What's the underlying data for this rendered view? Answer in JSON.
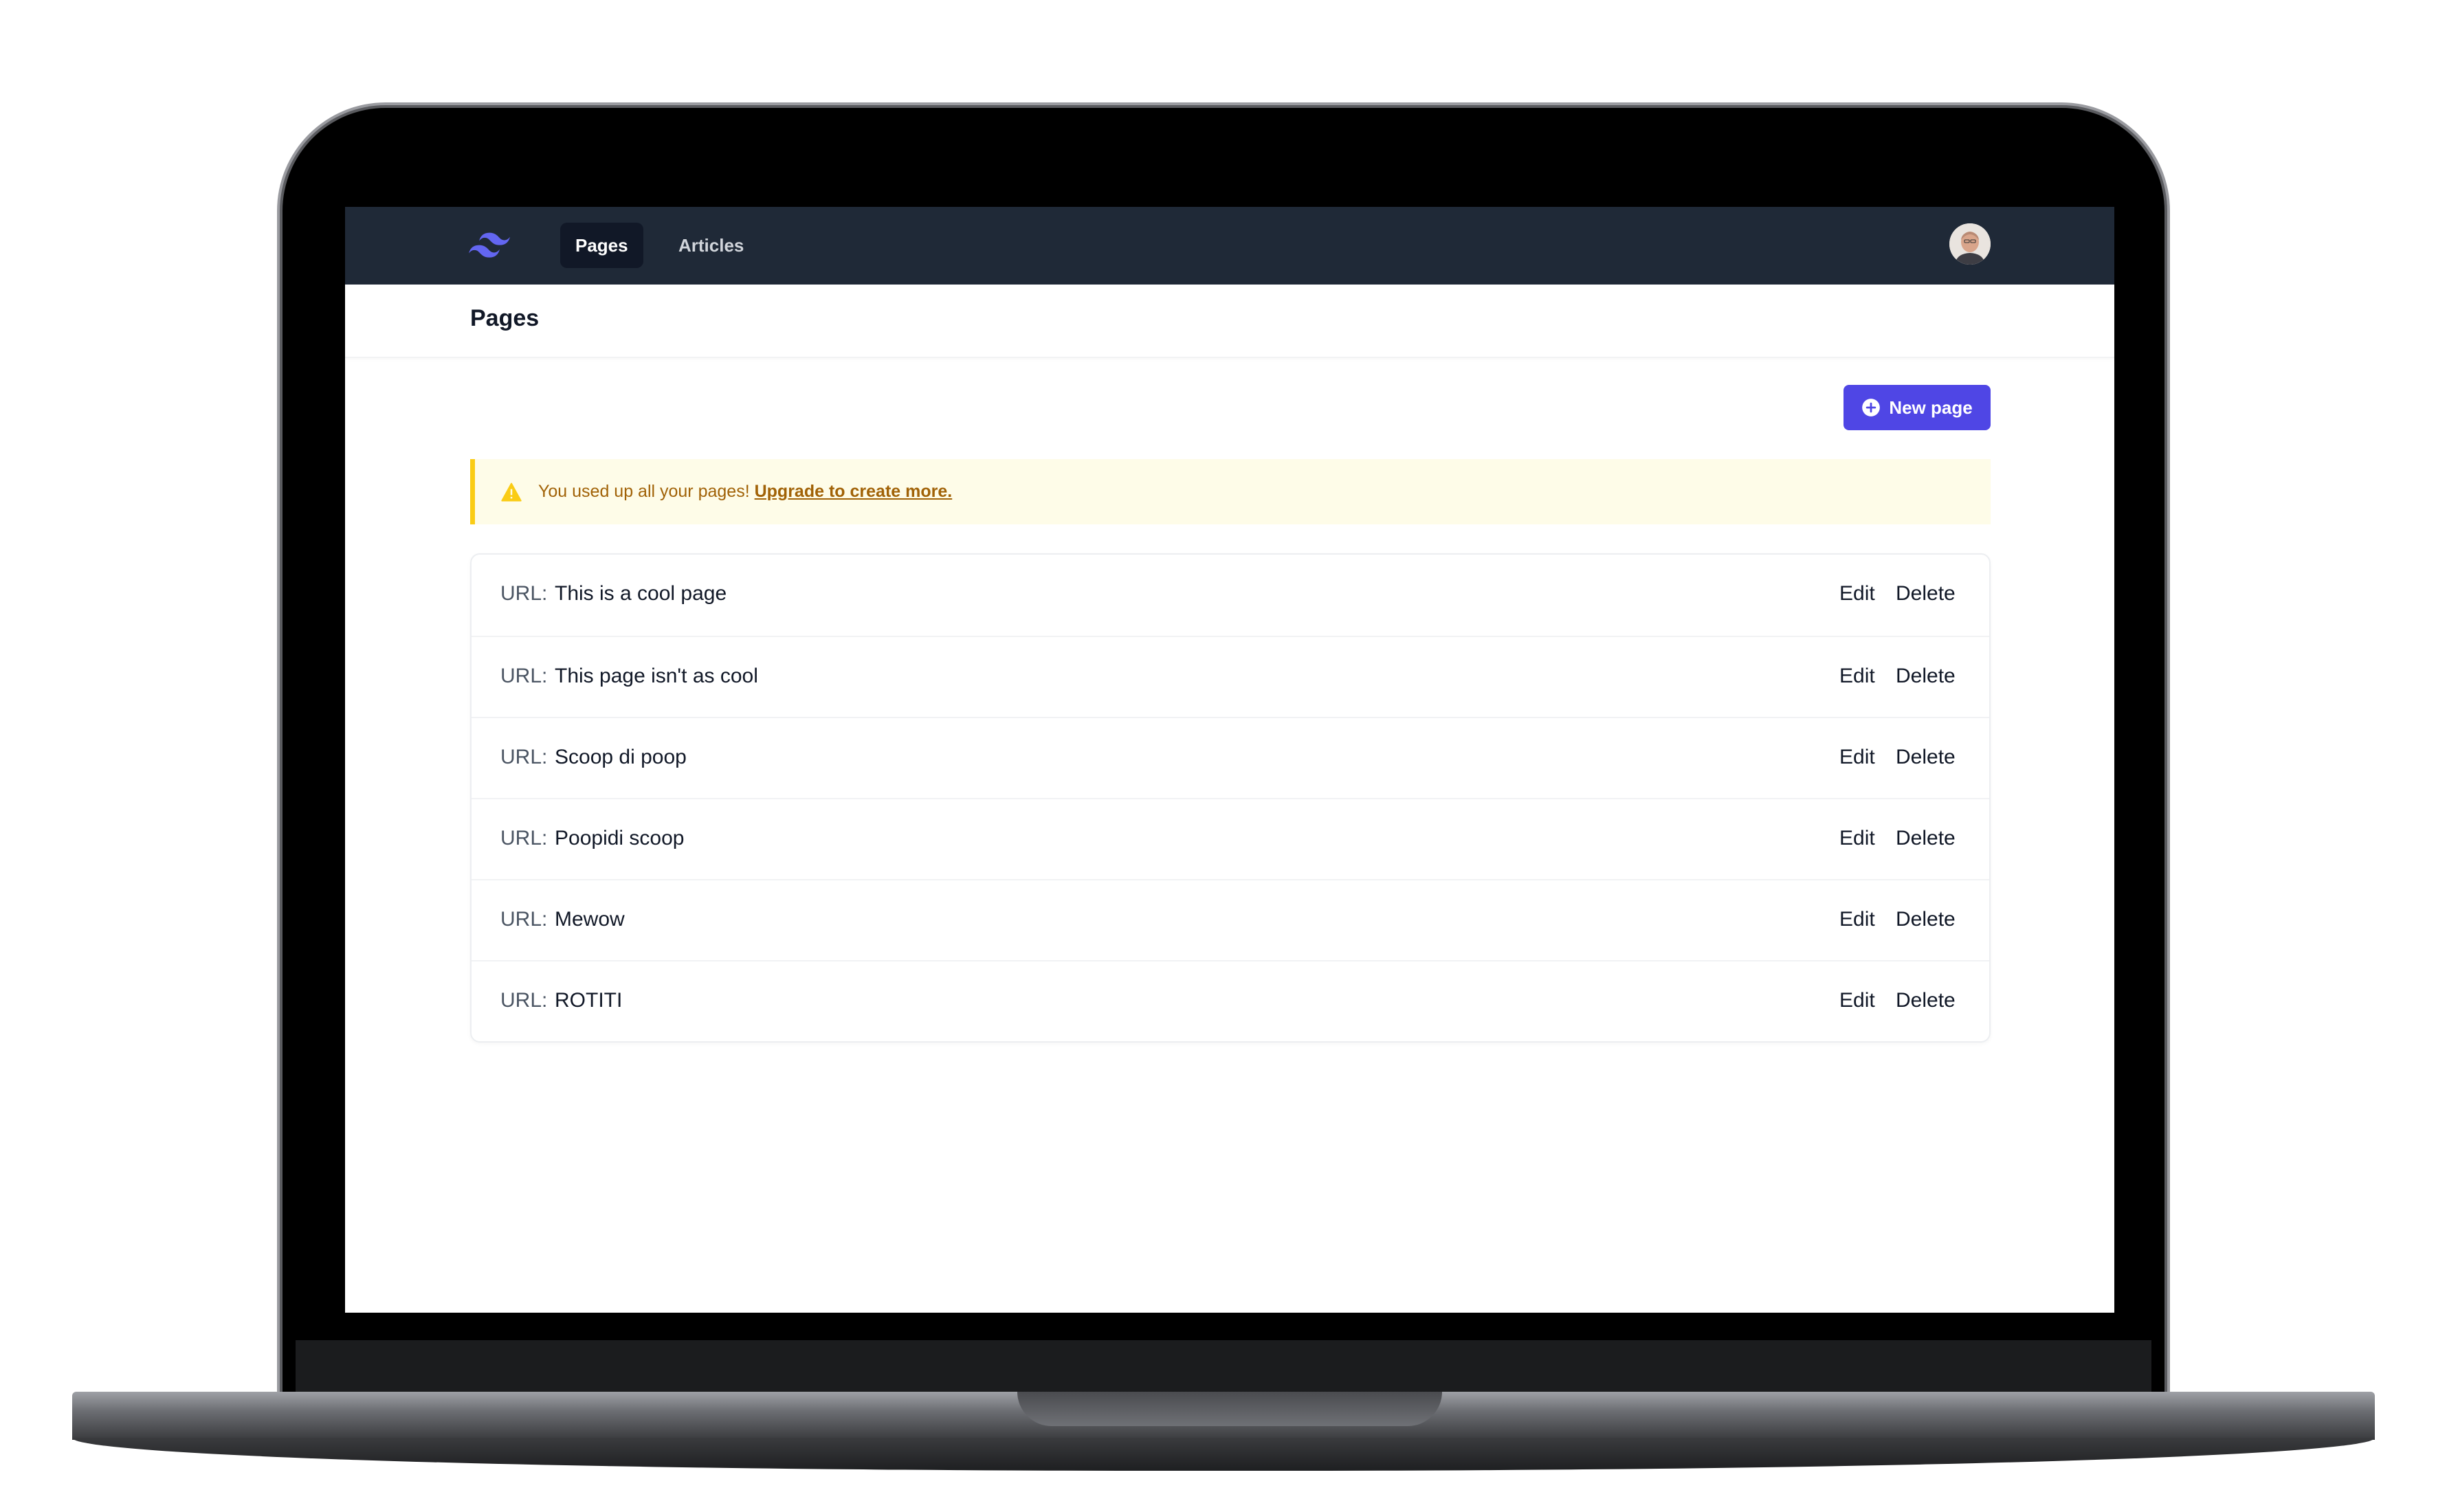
{
  "navbar": {
    "logo": "tailwind-logo-icon",
    "tabs": [
      {
        "label": "Pages",
        "active": true
      },
      {
        "label": "Articles",
        "active": false
      }
    ],
    "avatar": "user-avatar"
  },
  "header": {
    "title": "Pages"
  },
  "actions": {
    "new_page_label": "New page",
    "new_page_icon": "plus-circle-icon"
  },
  "alert": {
    "icon": "warning-icon",
    "text": "You used up all your pages!",
    "link": "Upgrade to create more."
  },
  "pages": [
    {
      "label": "URL:",
      "value": "This is a cool page",
      "edit": "Edit",
      "delete": "Delete"
    },
    {
      "label": "URL:",
      "value": "This page isn't as cool",
      "edit": "Edit",
      "delete": "Delete"
    },
    {
      "label": "URL:",
      "value": "Scoop di poop",
      "edit": "Edit",
      "delete": "Delete"
    },
    {
      "label": "URL:",
      "value": "Poopidi scoop",
      "edit": "Edit",
      "delete": "Delete"
    },
    {
      "label": "URL:",
      "value": "Mewow",
      "edit": "Edit",
      "delete": "Delete"
    },
    {
      "label": "URL:",
      "value": "ROTITI",
      "edit": "Edit",
      "delete": "Delete"
    }
  ],
  "colors": {
    "navbar_bg": "#1f2937",
    "primary": "#4f46e5",
    "alert_bg": "#fefce8",
    "alert_border": "#facc15",
    "alert_text": "#a16207"
  }
}
